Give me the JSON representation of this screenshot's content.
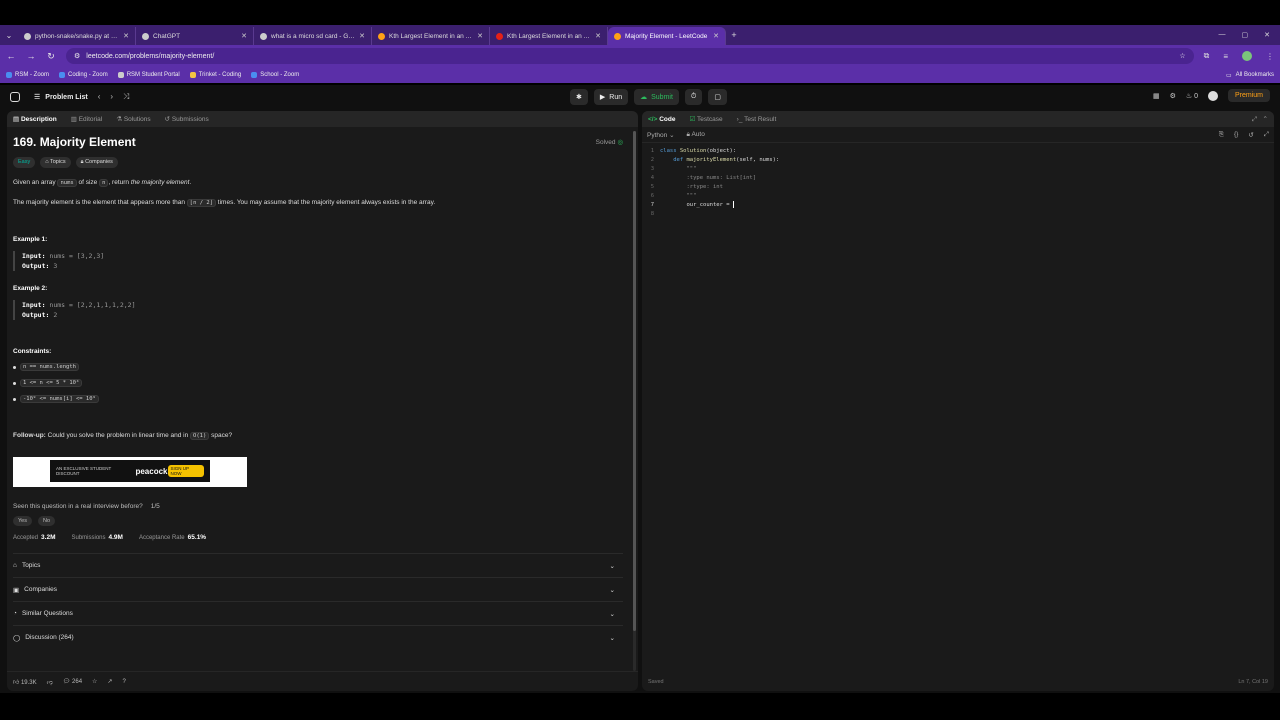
{
  "browser": {
    "tabs": [
      {
        "title": "python-snake/snake.py at mast",
        "active": false
      },
      {
        "title": "ChatGPT",
        "active": false
      },
      {
        "title": "what is a micro sd card - Googl",
        "active": false
      },
      {
        "title": "Kth Largest Element in an Array",
        "active": false
      },
      {
        "title": "Kth Largest Element in an Array",
        "active": false
      },
      {
        "title": "Majority Element - LeetCode",
        "active": true
      }
    ],
    "new_tab": "+",
    "url": "leetcode.com/problems/majority-element/",
    "bookmarks": [
      "RSM - Zoom",
      "Coding - Zoom",
      "RSM Student Portal",
      "Trinket - Coding",
      "School - Zoom"
    ],
    "all_bookmarks": "All Bookmarks",
    "colors": {
      "tabbar": "#3b1f6e",
      "toolbar": "#5b2fa8"
    }
  },
  "lc": {
    "problem_list": "Problem List",
    "run": "Run",
    "submit": "Submit",
    "streak": "0",
    "premium": "Premium"
  },
  "left": {
    "tabs": [
      "Description",
      "Editorial",
      "Solutions",
      "Submissions"
    ],
    "title": "169. Majority Element",
    "solved": "Solved",
    "badges": {
      "difficulty": "Easy",
      "topics": "Topics",
      "companies": "Companies"
    },
    "p1": {
      "a": "Given an array",
      "nums": "nums",
      "b": "of size",
      "n": "n",
      "c": ", return",
      "em": "the majority element",
      "d": "."
    },
    "p2": {
      "a": "The majority element is the element that appears more than",
      "code": "⌊n / 2⌋",
      "b": "times. You may assume that the majority element always exists in the array."
    },
    "example1": {
      "heading": "Example 1:",
      "input_label": "Input:",
      "input": "nums = [3,2,3]",
      "output_label": "Output:",
      "output": "3"
    },
    "example2": {
      "heading": "Example 2:",
      "input_label": "Input:",
      "input": "nums = [2,2,1,1,1,2,2]",
      "output_label": "Output:",
      "output": "2"
    },
    "constraints": {
      "heading": "Constraints:",
      "items": [
        "n == nums.length",
        "1 <= n <= 5 * 10⁴",
        "-10⁹ <= nums[i] <= 10⁹"
      ]
    },
    "followup": {
      "label": "Follow-up:",
      "text": "Could you solve the problem in linear time and in",
      "code": "O(1)",
      "end": "space?"
    },
    "ad": {
      "text": "AN EXCLUSIVE STUDENT DISCOUNT",
      "brand": "peacock",
      "cta": "SIGN UP NOW"
    },
    "seen": {
      "question": "Seen this question in a real interview before?",
      "count": "1/5",
      "yes": "Yes",
      "no": "No"
    },
    "stats": {
      "accepted_label": "Accepted",
      "accepted": "3.2M",
      "submissions_label": "Submissions",
      "submissions": "4.9M",
      "rate_label": "Acceptance Rate",
      "rate": "65.1%"
    },
    "sections": [
      "Topics",
      "Companies",
      "Similar Questions",
      "Discussion (264)"
    ],
    "footer": {
      "likes": "19.3K",
      "comments": "264"
    }
  },
  "right": {
    "tabs": [
      "Code",
      "Testcase",
      "Test Result"
    ],
    "language": "Python",
    "mode": "Auto",
    "code_lines": [
      "class Solution(object):",
      "    def majorityElement(self, nums):",
      "        \"\"\"",
      "        :type nums: List[int]",
      "        :rtype: int",
      "        \"\"\"",
      "        our_counter = ",
      ""
    ],
    "status": "Saved",
    "position": "Ln 7, Col 19"
  }
}
